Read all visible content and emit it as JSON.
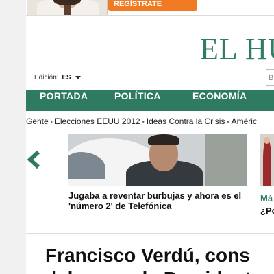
{
  "ad": {
    "cta_label": "REGÍSTRATE GRATIS",
    "cta_icon": "arrow-right-icon",
    "accent": "#f07b22"
  },
  "header": {
    "masthead": "EL HU",
    "brand_color": "#2f7d63"
  },
  "edition": {
    "label": "Edición:",
    "value": "ES",
    "dropdown_icon": "chevron-down-icon"
  },
  "search": {
    "value": "B"
  },
  "nav": {
    "background": "#2e7b62",
    "items": [
      {
        "label": "PORTADA"
      },
      {
        "label": "POLÍTICA"
      },
      {
        "label": "ECONOMÍA"
      }
    ]
  },
  "subnav": {
    "items": [
      {
        "label": "Gente"
      },
      {
        "label": "Elecciones EEUU 2012"
      },
      {
        "label": "Ideas Contra la Crisis"
      },
      {
        "label": "Améric"
      }
    ]
  },
  "carousel": {
    "prev_icon": "chevron-left-icon",
    "main_story": {
      "headline": "Jugaba a reventar burbujas y ahora es el 'número 2' de Telefónica"
    },
    "side_story": {
      "title": "Má",
      "subtitle": "¿Po"
    }
  },
  "article": {
    "title_line1": "Francisco Verdú, cons",
    "title_line2": "del cargo de Presidente"
  }
}
